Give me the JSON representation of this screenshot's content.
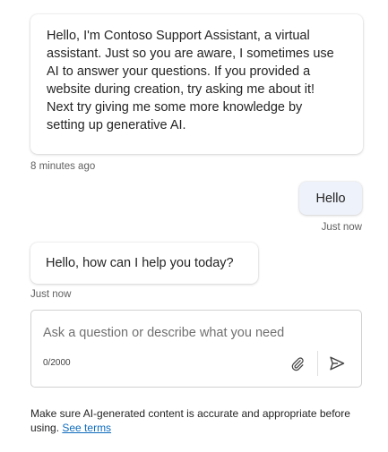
{
  "messages": {
    "bot_welcome": {
      "lines": [
        "Hello, I'm Contoso Support Assistant, a virtual",
        "assistant. Just so you are aware, I sometimes use",
        "AI to answer your questions. If you provided a",
        "website during creation, try asking me about it!",
        "Next try giving me some more knowledge by",
        "setting up generative AI."
      ],
      "timestamp": "8 minutes ago"
    },
    "user_hello": {
      "text": "Hello",
      "timestamp": "Just now"
    },
    "bot_reply": {
      "text": "Hello, how can I help you today?",
      "timestamp": "Just now"
    }
  },
  "composer": {
    "placeholder": "Ask a question or describe what you need",
    "char_count": "0/2000",
    "attach_icon": "paperclip-icon",
    "send_icon": "send-icon"
  },
  "footer": {
    "disclaimer": "Make sure AI-generated content is accurate and appropriate before using.",
    "terms_link": "See terms"
  },
  "colors": {
    "user_bubble": "#eef2fa",
    "link": "#0f6cbd",
    "muted_text": "#616161"
  }
}
